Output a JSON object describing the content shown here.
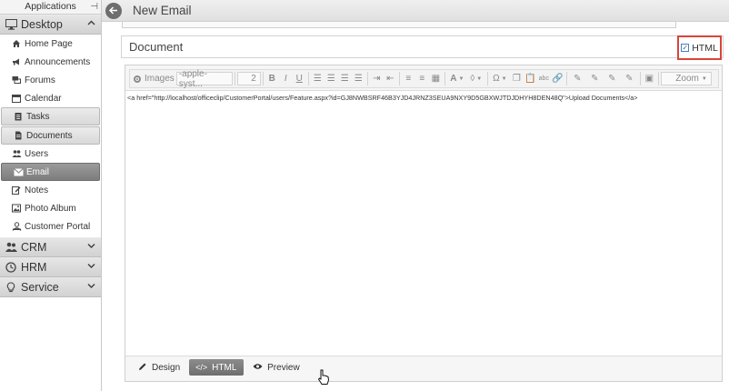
{
  "sidebar": {
    "apps_title": "Applications",
    "sections": [
      {
        "label": "Desktop",
        "icon": "monitor-icon",
        "expanded": true
      },
      {
        "label": "CRM",
        "icon": "people-icon",
        "expanded": false
      },
      {
        "label": "HRM",
        "icon": "clock-icon",
        "expanded": false
      },
      {
        "label": "Service",
        "icon": "lightbulb-icon",
        "expanded": false
      }
    ],
    "items": [
      {
        "label": "Home Page",
        "icon": "home-icon",
        "state": "normal"
      },
      {
        "label": "Announcements",
        "icon": "megaphone-icon",
        "state": "normal"
      },
      {
        "label": "Forums",
        "icon": "forum-icon",
        "state": "normal"
      },
      {
        "label": "Calendar",
        "icon": "calendar-icon",
        "state": "normal"
      },
      {
        "label": "Tasks",
        "icon": "clipboard-icon",
        "state": "boxed"
      },
      {
        "label": "Documents",
        "icon": "document-icon",
        "state": "boxed"
      },
      {
        "label": "Users",
        "icon": "users-icon",
        "state": "normal"
      },
      {
        "label": "Email",
        "icon": "envelope-icon",
        "state": "active"
      },
      {
        "label": "Notes",
        "icon": "pencil-icon",
        "state": "normal"
      },
      {
        "label": "Photo Album",
        "icon": "image-icon",
        "state": "normal"
      },
      {
        "label": "Customer Portal",
        "icon": "portal-icon",
        "state": "normal"
      }
    ]
  },
  "header": {
    "title": "New Email"
  },
  "subject": {
    "value": "Document"
  },
  "html_toggle": {
    "label": "HTML",
    "checked": true
  },
  "toolbar": {
    "images_label": "Images",
    "font_value": "-apple-syst...",
    "size_value": "2",
    "bold": "B",
    "italic": "I",
    "underline": "U",
    "color_letter": "A",
    "omega": "Ω",
    "zoom_value": "Zoom"
  },
  "editor": {
    "source": "<a href=\"http://localhost/officeclip/CustomerPortal/users/Feature.aspx?id=GJ8NWBSRF46B3YJD4JRNZ3SEUA9NXY9D5GBXWJTDJDHYH8DEN48Q\">Upload Documents</a>"
  },
  "modes": [
    {
      "label": "Design",
      "icon": "pencil-icon",
      "active": false
    },
    {
      "label": "HTML",
      "icon": "code-icon",
      "active": true
    },
    {
      "label": "Preview",
      "icon": "eye-icon",
      "active": false
    }
  ],
  "colors": {
    "accent_border": "#d9443a",
    "active_nav": "#7d7d7d"
  }
}
